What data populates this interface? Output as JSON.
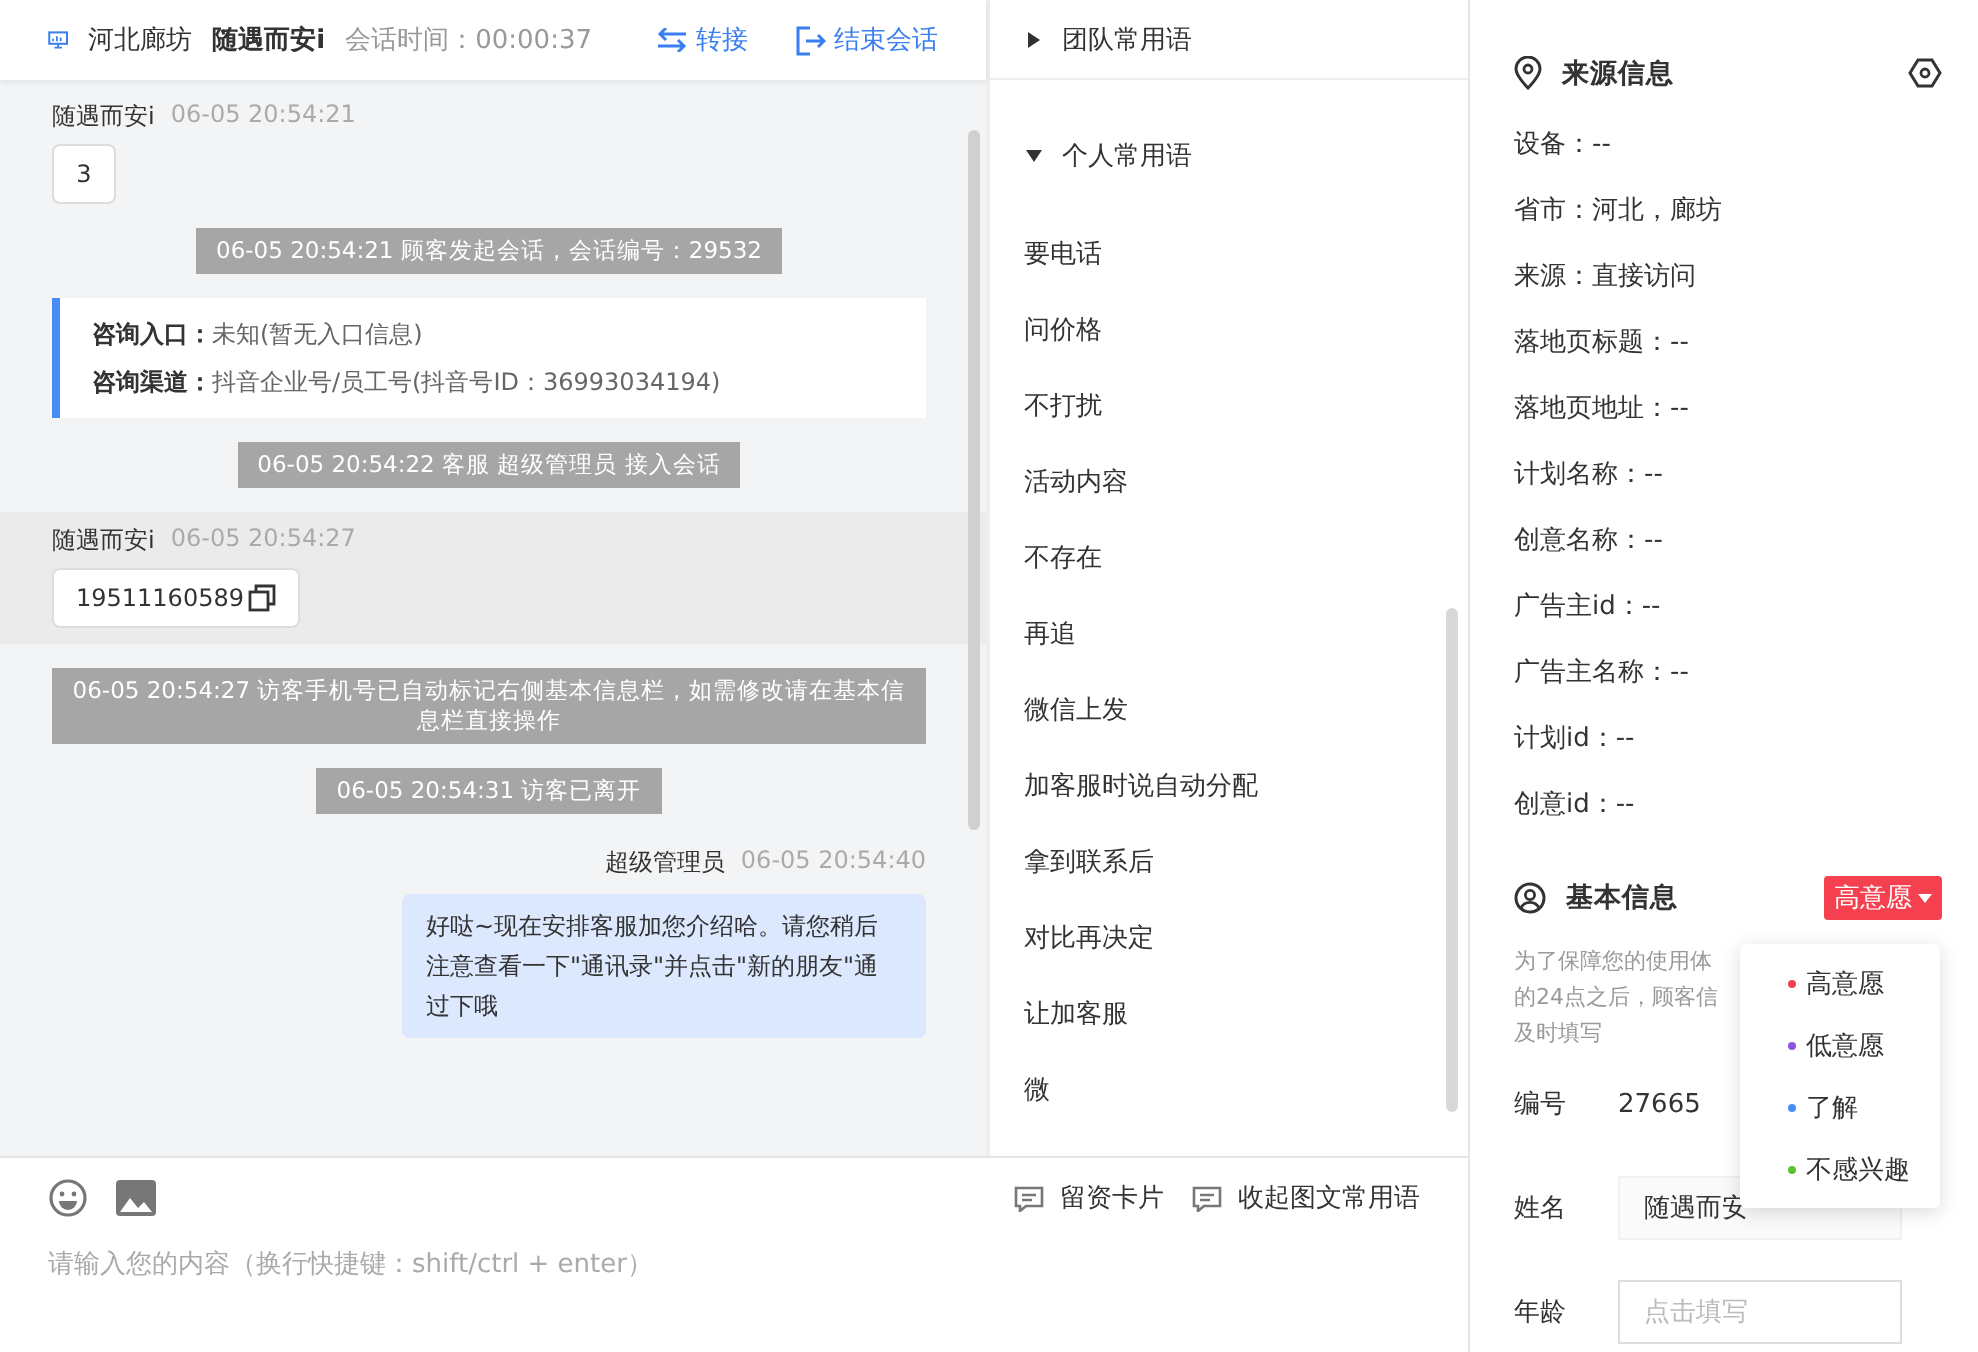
{
  "header": {
    "location": "河北廊坊",
    "visitor": "随遇而安i",
    "duration_label": "会话时间：00:00:37",
    "actions": [
      {
        "kind": "transfer",
        "label": "转接"
      },
      {
        "kind": "end",
        "label": "结束会话"
      }
    ]
  },
  "messages": [
    {
      "kind": "visitor",
      "name": "随遇而安i",
      "time": "06-05 20:54:21",
      "text": "3",
      "highlighted": false,
      "copyable": false
    },
    {
      "kind": "system",
      "text": "06-05 20:54:21 顾客发起会话，会话编号：29532"
    },
    {
      "kind": "info",
      "lines": [
        {
          "label": "咨询入口：",
          "value": "未知(暂无入口信息)"
        },
        {
          "label": "咨询渠道：",
          "value": "抖音企业号/员工号(抖音号ID：36993034194)"
        }
      ]
    },
    {
      "kind": "system",
      "text": "06-05 20:54:22 客服 超级管理员 接入会话"
    },
    {
      "kind": "visitor",
      "name": "随遇而安i",
      "time": "06-05 20:54:27",
      "text": "19511160589",
      "highlighted": true,
      "copyable": true
    },
    {
      "kind": "system",
      "text": "06-05 20:54:27 访客手机号已自动标记右侧基本信息栏，如需修改请在基本信息栏直接操作"
    },
    {
      "kind": "system",
      "text": "06-05 20:54:31 访客已离开"
    },
    {
      "kind": "agent",
      "name": "超级管理员",
      "time": "06-05 20:54:40",
      "text": "好哒~现在安排客服加您介绍哈。请您稍后注意查看一下\"通讯录\"并点击\"新的朋友\"通过下哦"
    }
  ],
  "input": {
    "placeholder": "请输入您的内容（换行快捷键：shift/ctrl + enter）",
    "tools": [
      "留资卡片",
      "收起图文常用语"
    ]
  },
  "phrases": {
    "groups": [
      {
        "title": "团队常用语",
        "expanded": false
      },
      {
        "title": "个人常用语",
        "expanded": true
      }
    ],
    "items": [
      "要电话",
      "问价格",
      "不打扰",
      "活动内容",
      "不存在",
      "再追",
      "微信上发",
      "加客服时说自动分配",
      "拿到联系后",
      "对比再决定",
      "让加客服",
      "微"
    ]
  },
  "source_info": {
    "title": "来源信息",
    "rows": [
      "设备：--",
      "省市：河北，廊坊",
      "来源：直接访问",
      "落地页标题：--",
      "落地页地址：--",
      "计划名称：--",
      "创意名称：--",
      "广告主id：--",
      "广告主名称：--",
      "计划id：--",
      "创意id：--"
    ]
  },
  "basic_info": {
    "title": "基本信息",
    "intent": {
      "label": "高意愿",
      "color": "#f5414f"
    },
    "hint_lines": [
      "为了保障您的使用体",
      "的24点之后，顾客信",
      "及时填写"
    ],
    "id_label": "编号",
    "id_value": "27665",
    "fields": [
      {
        "label": "姓名",
        "value": "随遇而安"
      },
      {
        "label": "年龄",
        "placeholder": "点击填写"
      }
    ],
    "intent_options": [
      {
        "label": "高意愿",
        "color": "#f5414f"
      },
      {
        "label": "低意愿",
        "color": "#8e53e0"
      },
      {
        "label": "了解",
        "color": "#4a8cf7"
      },
      {
        "label": "不感兴趣",
        "color": "#5cc22f"
      }
    ]
  }
}
